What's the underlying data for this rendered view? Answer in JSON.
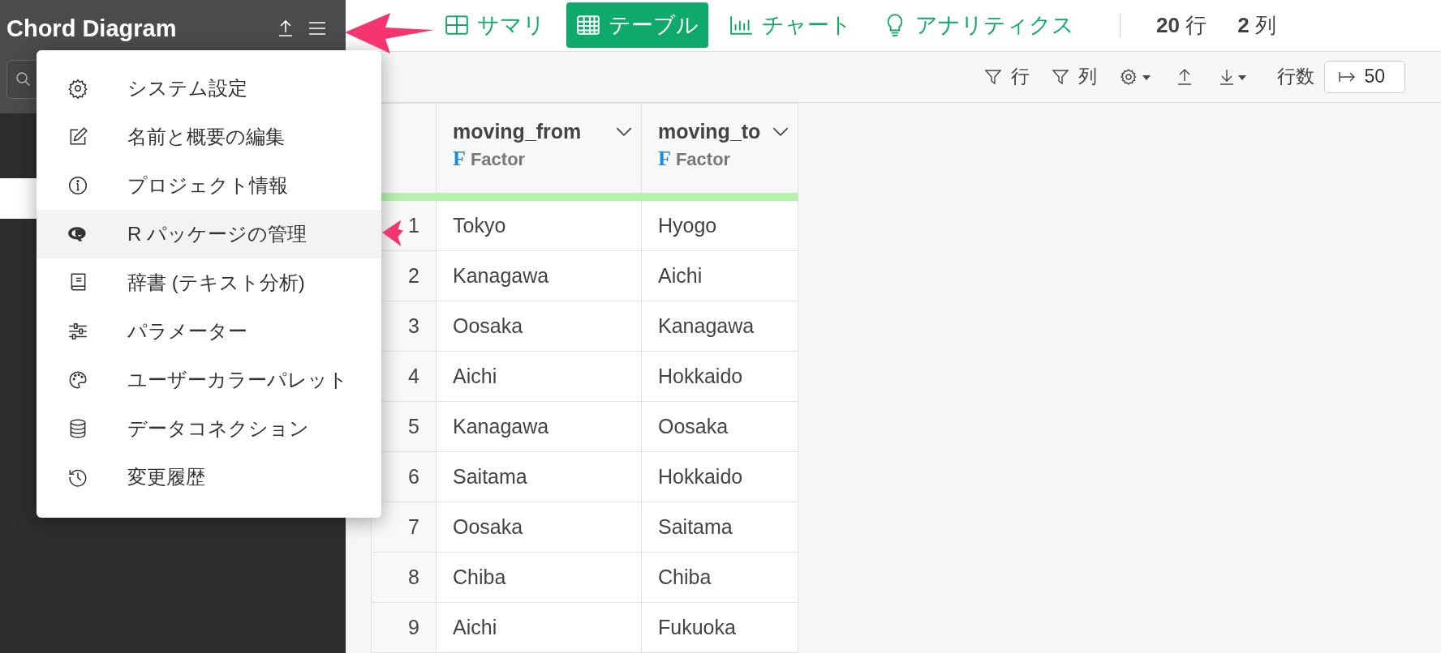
{
  "project": {
    "title": "Chord Diagram"
  },
  "menu": {
    "items": [
      {
        "label": "システム設定",
        "kind": "gear",
        "selected": false
      },
      {
        "label": "名前と概要の編集",
        "kind": "edit",
        "selected": false
      },
      {
        "label": "プロジェクト情報",
        "kind": "info",
        "selected": false
      },
      {
        "label": "R パッケージの管理",
        "kind": "r",
        "selected": true
      },
      {
        "label": "辞書 (テキスト分析)",
        "kind": "book",
        "selected": false
      },
      {
        "label": "パラメーター",
        "kind": "sliders",
        "selected": false
      },
      {
        "label": "ユーザーカラーパレット",
        "kind": "palette",
        "selected": false
      },
      {
        "label": "データコネクション",
        "kind": "database",
        "selected": false
      },
      {
        "label": "変更履歴",
        "kind": "history",
        "selected": false
      }
    ]
  },
  "view_tabs": [
    {
      "label": "サマリ",
      "kind": "summary",
      "selected": false
    },
    {
      "label": "テーブル",
      "kind": "table",
      "selected": true
    },
    {
      "label": "チャート",
      "kind": "chart",
      "selected": false
    },
    {
      "label": "アナリティクス",
      "kind": "bulb",
      "selected": false
    }
  ],
  "counts": [
    {
      "value": "20",
      "unit": "行"
    },
    {
      "value": "2",
      "unit": "列"
    }
  ],
  "toolbar": {
    "row_filter": "行",
    "column_filter": "列",
    "rows_label": "行数",
    "rows_value": "50"
  },
  "table": {
    "columns": [
      {
        "name": "moving_from",
        "type_badge": "F",
        "type": "Factor"
      },
      {
        "name": "moving_to",
        "type_badge": "F",
        "type": "Factor"
      }
    ],
    "rows": [
      {
        "number": "1",
        "cells": [
          "Tokyo",
          "Hyogo"
        ]
      },
      {
        "number": "2",
        "cells": [
          "Kanagawa",
          "Aichi"
        ]
      },
      {
        "number": "3",
        "cells": [
          "Oosaka",
          "Kanagawa"
        ]
      },
      {
        "number": "4",
        "cells": [
          "Aichi",
          "Hokkaido"
        ]
      },
      {
        "number": "5",
        "cells": [
          "Kanagawa",
          "Oosaka"
        ]
      },
      {
        "number": "6",
        "cells": [
          "Saitama",
          "Hokkaido"
        ]
      },
      {
        "number": "7",
        "cells": [
          "Oosaka",
          "Saitama"
        ]
      },
      {
        "number": "8",
        "cells": [
          "Chiba",
          "Chiba"
        ]
      },
      {
        "number": "9",
        "cells": [
          "Aichi",
          "Fukuoka"
        ]
      }
    ]
  }
}
